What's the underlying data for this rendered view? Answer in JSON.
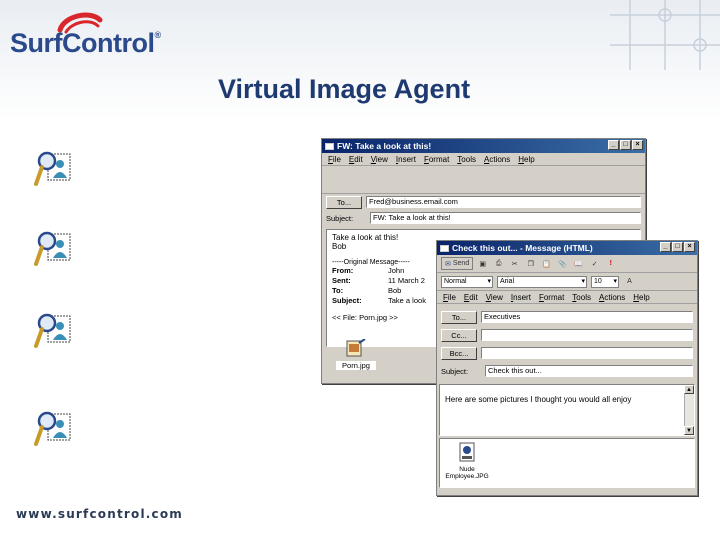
{
  "slide": {
    "logo_text": "SurfControl",
    "logo_mark": "®",
    "title": "Virtual Image Agent",
    "footer_url": "www.surfcontrol.com",
    "icons": [
      "magnifier-user-icon",
      "magnifier-user-icon",
      "magnifier-user-icon",
      "magnifier-user-icon"
    ],
    "accent_color": "#2b4a8c",
    "title_color": "#1f3a70"
  },
  "fw_window": {
    "title": "FW: Take a look at this!",
    "menu": [
      "File",
      "Edit",
      "View",
      "Insert",
      "Format",
      "Tools",
      "Actions",
      "Help"
    ],
    "to_label": "To...",
    "to_value": "Fred@business.email.com",
    "subject_label": "Subject:",
    "subject_value": "FW: Take a look at this!",
    "body_line1": "Take a look at this!",
    "body_line2": "Bob",
    "original_header": "-----Original Message-----",
    "from_key": "From:",
    "from_val": "John",
    "sent_key": "Sent:",
    "sent_val": "11 March 2",
    "to_key": "To:",
    "to_val": "Bob",
    "subj_key": "Subject:",
    "subj_val": "Take a look",
    "attachment_ref": "<< File: Porn.jpg >>",
    "attachment_name": "Porn.jpg",
    "title_buttons": [
      "_",
      "□",
      "×"
    ]
  },
  "html_window": {
    "title": "Check this out... - Message (HTML)",
    "send_label": "Send",
    "style_value": "Normal",
    "font_value": "Arial",
    "size_value": "10",
    "menu": [
      "File",
      "Edit",
      "View",
      "Insert",
      "Format",
      "Tools",
      "Actions",
      "Help"
    ],
    "to_label": "To...",
    "to_value": "Executives",
    "cc_label": "Cc...",
    "cc_value": "",
    "bcc_label": "Bcc...",
    "bcc_value": "",
    "subject_label": "Subject:",
    "subject_value": "Check this out...",
    "body_text": "Here are some pictures I thought you would all enjoy",
    "attachment_line1": "Nude",
    "attachment_line2": "Employee.JPG",
    "title_buttons": [
      "_",
      "□",
      "×"
    ]
  }
}
